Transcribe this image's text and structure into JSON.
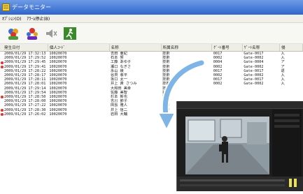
{
  "window": {
    "title": "データモニター",
    "menu": [
      "ｵﾌﾟｼｮﾝ(O)",
      "ｱﾗｰﾑ停止(B)"
    ]
  },
  "toolbar": {
    "buttons": [
      {
        "icon": "group-users-icon"
      },
      {
        "icon": "alert-users-icon"
      },
      {
        "icon": "speaker-mute-icon"
      },
      {
        "icon": "running-person-icon"
      }
    ]
  },
  "table": {
    "columns": [
      "発生日付",
      "個人ｺｰﾄﾞ",
      "名称",
      "所属名称",
      "ｹﾞｰﾄ番号",
      "ｹﾞｰﾄ名称",
      "侵"
    ],
    "rows": [
      {
        "time": "2009/01/29 17:32:13",
        "id": "10020070",
        "name": "吉田 亜紀",
        "dept": "技術",
        "gate_no": "0017",
        "gate_name": "Gate-0017",
        "extra": "入",
        "alert": false
      },
      {
        "time": "2009/01/29 17:29:52",
        "id": "10020070",
        "name": "石本 努",
        "dept": "技術",
        "gate_no": "0002",
        "gate_name": "Gate-0002",
        "extra": "入",
        "alert": false
      },
      {
        "time": "2009/01/29 17:29:45",
        "id": "10020070",
        "name": "工藤 あゆ子",
        "dept": "技術",
        "gate_no": "0004",
        "gate_name": "Gate-0004",
        "extra": "ア",
        "alert": true
      },
      {
        "time": "2009/01/29 17:29:41",
        "id": "10020070",
        "name": "瀬口 なぎさ",
        "dept": "技術",
        "gate_no": "0002",
        "gate_name": "Gate-0002",
        "extra": "ア",
        "alert": true
      },
      {
        "time": "2009/01/29 17:28:22",
        "id": "10020070",
        "name": "永山 綾",
        "dept": "技術",
        "gate_no": "0017",
        "gate_name": "Gate-0017",
        "extra": "退",
        "alert": false
      },
      {
        "time": "2009/01/29 17:28:17",
        "id": "10020070",
        "name": "谷貝 孝平",
        "dept": "技術",
        "gate_no": "0002",
        "gate_name": "Gate-0002",
        "extra": "入",
        "alert": false
      },
      {
        "time": "2009/01/29 17:28:11",
        "id": "10020070",
        "name": "坂口 太一",
        "dept": "技術",
        "gate_no": "0017",
        "gate_name": "Gate-0017",
        "extra": "入",
        "alert": false
      },
      {
        "time": "2009/01/29 17:28:01",
        "id": "10020070",
        "name": "井上 貴 さつみ",
        "dept": "技術",
        "gate_no": "0002",
        "gate_name": "Gate-0002",
        "extra": "入",
        "alert": false
      },
      {
        "time": "2009/01/29 17:29:14",
        "id": "10020070",
        "name": "大和田 美幸",
        "dept": "技術",
        "gate_no": "",
        "gate_name": "",
        "extra": "",
        "alert": false
      },
      {
        "time": "2009/01/29 17:29:54",
        "id": "10020070",
        "name": "佐藤 美智",
        "dept": "技術",
        "gate_no": "",
        "gate_name": "",
        "extra": "",
        "alert": false
      },
      {
        "time": "2009/01/29 17:28:50",
        "id": "10020070",
        "name": "杉本 新也",
        "dept": "技術",
        "gate_no": "",
        "gate_name": "",
        "extra": "",
        "alert": true
      },
      {
        "time": "2009/01/29 17:28:00",
        "id": "10020070",
        "name": "吉川 節子",
        "dept": "技術",
        "gate_no": "",
        "gate_name": "",
        "extra": "",
        "alert": false
      },
      {
        "time": "2009/01/29 17:27:22",
        "id": "10020070",
        "name": "田島 雅人",
        "dept": "技術",
        "gate_no": "",
        "gate_name": "",
        "extra": "",
        "alert": false
      },
      {
        "time": "2009/01/29 17:28:30",
        "id": "10020070",
        "name": "井上 信二",
        "dept": "技術",
        "gate_no": "",
        "gate_name": "",
        "extra": "",
        "alert": true
      },
      {
        "time": "2009/01/29 17:26:02",
        "id": "10020070",
        "name": "岩田 大輔",
        "dept": "技術",
        "gate_no": "",
        "gate_name": "",
        "extra": "",
        "alert": true
      }
    ]
  },
  "colors": {
    "titlebar": "#3a6fd0",
    "alert_dot": "#e83030",
    "arrow": "#7fb4e6"
  }
}
